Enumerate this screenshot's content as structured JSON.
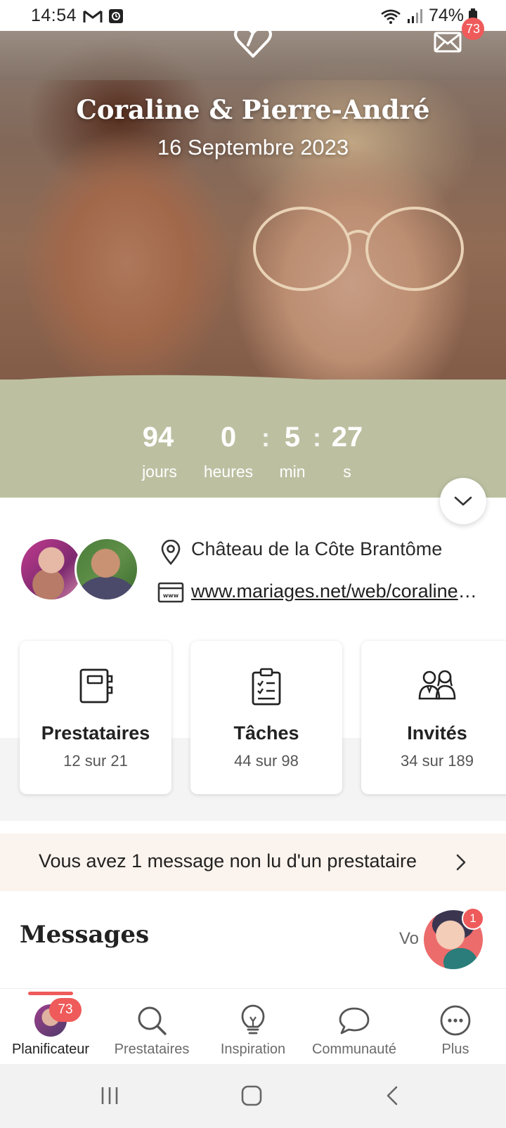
{
  "status_bar": {
    "time": "14:54",
    "battery": "74%",
    "icons": [
      "gmail-icon",
      "notification-icon",
      "wifi-icon",
      "signal-icon",
      "battery-icon"
    ]
  },
  "hero": {
    "couple_names": "Coraline & Pierre-André",
    "wedding_date": "16 Septembre 2023",
    "mail_badge": "73",
    "icons": [
      "heart-logo-icon",
      "mail-icon"
    ]
  },
  "countdown": {
    "days": "94",
    "days_label": "jours",
    "hours": "0",
    "hours_label": "heures",
    "minutes": "5",
    "minutes_label": "min",
    "seconds": "27",
    "seconds_label": "s",
    "separator": ":"
  },
  "info": {
    "location": "Château de la Côte Brantôme",
    "website": "www.mariages.net/web/coraline-et-pierre-andre"
  },
  "cards": [
    {
      "title": "Prestataires",
      "subtitle": "12 sur 21",
      "icon": "notebook-icon"
    },
    {
      "title": "Tâches",
      "subtitle": "44 sur 98",
      "icon": "checklist-icon"
    },
    {
      "title": "Invités",
      "subtitle": "34 sur 189",
      "icon": "guests-icon"
    }
  ],
  "banner": {
    "text": "Vous avez 1 message non lu d'un prestataire"
  },
  "messages": {
    "title": "Messages",
    "link": "Vo",
    "assistant_badge": "1"
  },
  "bottom_nav": {
    "items": [
      {
        "label": "Planificateur",
        "badge": "73",
        "icon": "profile-avatar-icon",
        "active": true
      },
      {
        "label": "Prestataires",
        "icon": "search-icon"
      },
      {
        "label": "Inspiration",
        "icon": "lightbulb-icon"
      },
      {
        "label": "Communauté",
        "icon": "chat-bubble-icon"
      },
      {
        "label": "Plus",
        "icon": "more-icon"
      }
    ]
  },
  "colors": {
    "accent": "#ef5a5a",
    "countdown_band": "#bcc0a1",
    "banner_bg": "#fbf3ed"
  }
}
